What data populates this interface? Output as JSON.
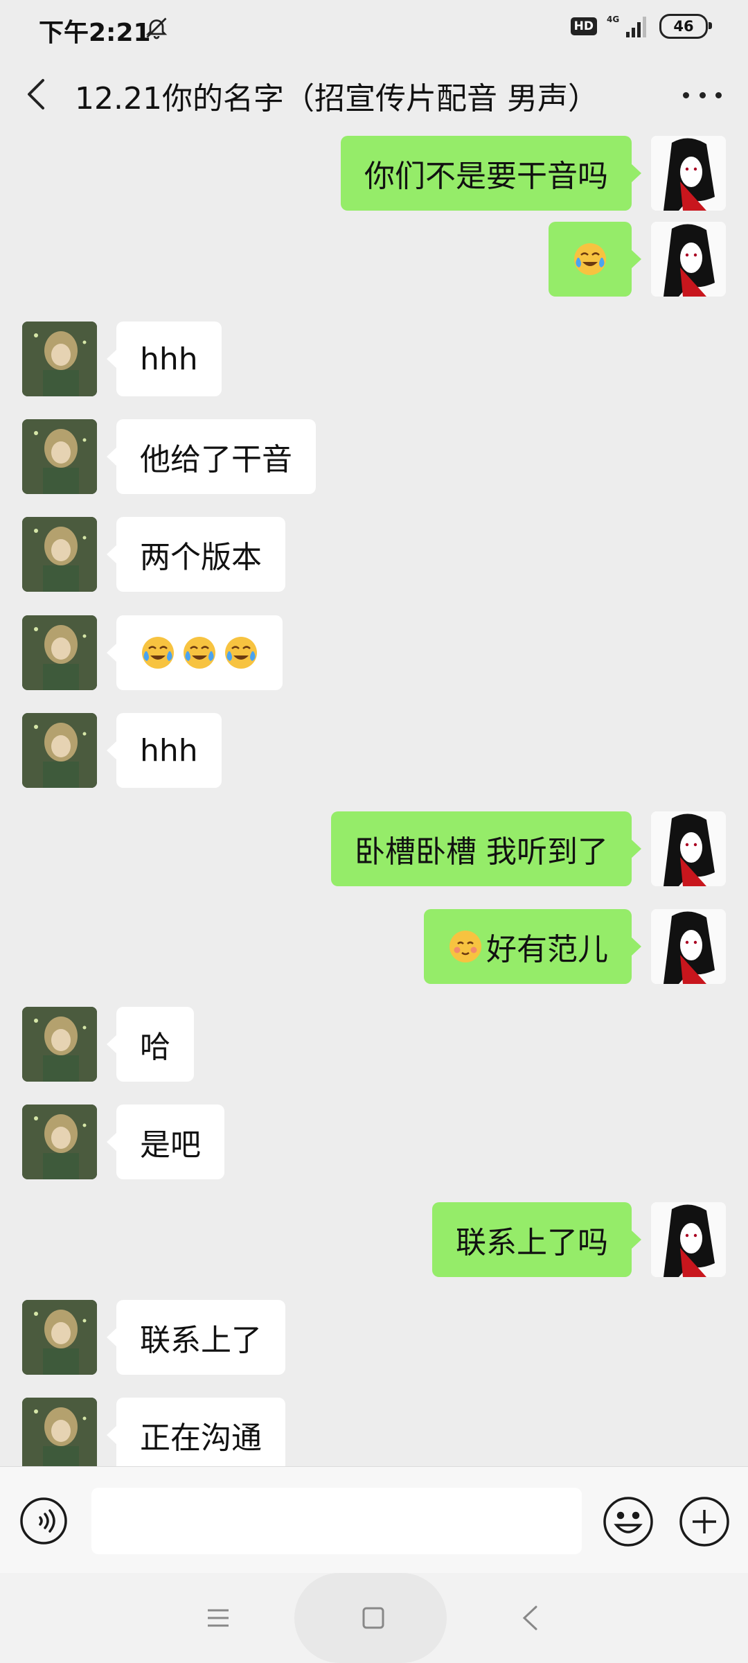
{
  "status_bar": {
    "time": "下午2:21",
    "hd_badge": "HD",
    "network": "4G",
    "battery": "46"
  },
  "header": {
    "title": "12.21你的名字（招宣传片配音 男声）"
  },
  "messages": [
    {
      "side": "out",
      "text": "你们不是要干音吗"
    },
    {
      "side": "out",
      "emoji": [
        "crying-laughing"
      ]
    },
    {
      "side": "in",
      "text": "hhh"
    },
    {
      "side": "in",
      "text": "他给了干音"
    },
    {
      "side": "in",
      "text": "两个版本"
    },
    {
      "side": "in",
      "emoji": [
        "crying-laughing",
        "crying-laughing",
        "crying-laughing"
      ]
    },
    {
      "side": "in",
      "text": "hhh"
    },
    {
      "side": "out",
      "text": "卧槽卧槽 我听到了"
    },
    {
      "side": "out",
      "emoji": [
        "blushing-smile"
      ],
      "text": "好有范儿"
    },
    {
      "side": "in",
      "text": "哈"
    },
    {
      "side": "in",
      "text": "是吧"
    },
    {
      "side": "out",
      "text": "联系上了吗"
    },
    {
      "side": "in",
      "text": "联系上了"
    },
    {
      "side": "in",
      "text": "正在沟通"
    }
  ],
  "input_bar": {
    "voice_icon": "voice-icon",
    "input_value": "",
    "emoji_icon": "smiley-icon",
    "more_icon": "plus-icon"
  },
  "colors": {
    "background": "#ededed",
    "outgoing_bubble": "#95ec69",
    "incoming_bubble": "#ffffff"
  }
}
